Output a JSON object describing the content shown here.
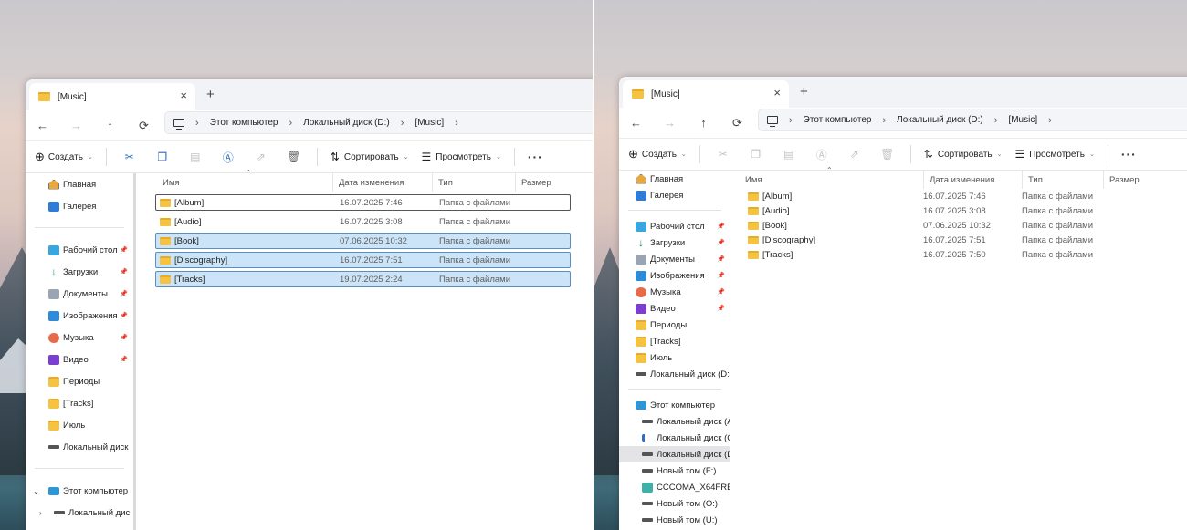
{
  "colors": {
    "folder": "#f5c342",
    "selection": "#cce4f7",
    "selection_border": "#5a8fc4",
    "titlebar": "#f1f3f6"
  },
  "left": {
    "tab": {
      "title": "[Music]",
      "close": "×"
    },
    "new_tab": "+",
    "nav": {
      "back": "←",
      "forward": "→",
      "up": "↑",
      "refresh": "⟳"
    },
    "breadcrumb": [
      "Этот компьютер",
      "Локальный диск (D:)",
      "[Music]"
    ],
    "toolbar": {
      "create": "Создать",
      "sort": "Сортировать",
      "view": "Просмотреть",
      "more": "···"
    },
    "sidebar": [
      {
        "label": "Главная",
        "icon": "home-icon",
        "pin": false
      },
      {
        "label": "Галерея",
        "icon": "gallery-icon",
        "pin": false
      },
      {
        "gap": true
      },
      {
        "label": "Рабочий стол",
        "icon": "desktop-icon",
        "pin": true
      },
      {
        "label": "Загрузки",
        "icon": "download-icon",
        "pin": true
      },
      {
        "label": "Документы",
        "icon": "documents-icon",
        "pin": true
      },
      {
        "label": "Изображения",
        "icon": "images-icon",
        "pin": true
      },
      {
        "label": "Музыка",
        "icon": "music-icon",
        "pin": true
      },
      {
        "label": "Видео",
        "icon": "video-icon",
        "pin": true
      },
      {
        "label": "Периоды",
        "icon": "folder-icon",
        "pin": false
      },
      {
        "label": "[Tracks]",
        "icon": "folder-icon",
        "pin": false
      },
      {
        "label": "Июль",
        "icon": "folder-icon",
        "pin": false
      },
      {
        "label": "Локальный диск",
        "icon": "drive-icon",
        "pin": false
      },
      {
        "gap": true
      },
      {
        "label": "Этот компьютер",
        "icon": "pc-icon",
        "expander": "⌄"
      },
      {
        "label": "Локальный дис",
        "icon": "drive-icon",
        "expander": "›",
        "indent": true
      }
    ],
    "columns": [
      "Имя",
      "Дата изменения",
      "Тип",
      "Размер"
    ],
    "rows": [
      {
        "name": "[Album]",
        "date": "16.07.2025 7:46",
        "type": "Папка с файлами",
        "state": "focused"
      },
      {
        "name": "[Audio]",
        "date": "16.07.2025 3:08",
        "type": "Папка с файлами",
        "state": ""
      },
      {
        "name": "[Book]",
        "date": "07.06.2025 10:32",
        "type": "Папка с файлами",
        "state": "selected"
      },
      {
        "name": "[Discography]",
        "date": "16.07.2025 7:51",
        "type": "Папка с файлами",
        "state": "selected"
      },
      {
        "name": "[Tracks]",
        "date": "19.07.2025 2:24",
        "type": "Папка с файлами",
        "state": "selected"
      }
    ]
  },
  "right": {
    "tab": {
      "title": "[Music]",
      "close": "×"
    },
    "new_tab": "+",
    "nav": {
      "back": "←",
      "forward": "→",
      "up": "↑",
      "refresh": "⟳"
    },
    "breadcrumb": [
      "Этот компьютер",
      "Локальный диск (D:)",
      "[Music]"
    ],
    "toolbar": {
      "create": "Создать",
      "sort": "Сортировать",
      "view": "Просмотреть",
      "more": "···"
    },
    "sidebar": [
      {
        "label": "Главная",
        "icon": "home-icon",
        "pin": false
      },
      {
        "label": "Галерея",
        "icon": "gallery-icon",
        "pin": false
      },
      {
        "gap": true
      },
      {
        "label": "Рабочий стол",
        "icon": "desktop-icon",
        "pin": true
      },
      {
        "label": "Загрузки",
        "icon": "download-icon",
        "pin": true
      },
      {
        "label": "Документы",
        "icon": "documents-icon",
        "pin": true
      },
      {
        "label": "Изображения",
        "icon": "images-icon",
        "pin": true
      },
      {
        "label": "Музыка",
        "icon": "music-icon",
        "pin": true
      },
      {
        "label": "Видео",
        "icon": "video-icon",
        "pin": true
      },
      {
        "label": "Периоды",
        "icon": "folder-icon",
        "pin": false
      },
      {
        "label": "[Tracks]",
        "icon": "folder-icon",
        "pin": false
      },
      {
        "label": "Июль",
        "icon": "folder-icon",
        "pin": false
      },
      {
        "label": "Локальный диск (D:)",
        "icon": "drive-icon",
        "pin": false
      },
      {
        "gap": true
      },
      {
        "label": "Этот компьютер",
        "icon": "pc-icon"
      },
      {
        "label": "Локальный диск (A:",
        "icon": "drive-icon",
        "indent": true
      },
      {
        "label": "Локальный диск (C:",
        "icon": "drive-c-icon",
        "indent": true
      },
      {
        "label": "Локальный диск (D:",
        "icon": "drive-icon",
        "indent": true,
        "selected": true
      },
      {
        "label": "Новый том (F:)",
        "icon": "drive-icon",
        "indent": true
      },
      {
        "label": "CCCOMA_X64FRE_R",
        "icon": "cd-icon",
        "indent": true
      },
      {
        "label": "Новый том (O:)",
        "icon": "drive-icon",
        "indent": true
      },
      {
        "label": "Новый том (U:)",
        "icon": "drive-icon",
        "indent": true
      }
    ],
    "columns": [
      "Имя",
      "Дата изменения",
      "Тип",
      "Размер"
    ],
    "rows": [
      {
        "name": "[Album]",
        "date": "16.07.2025 7:46",
        "type": "Папка с файлами",
        "state": ""
      },
      {
        "name": "[Audio]",
        "date": "16.07.2025 3:08",
        "type": "Папка с файлами",
        "state": ""
      },
      {
        "name": "[Book]",
        "date": "07.06.2025 10:32",
        "type": "Папка с файлами",
        "state": ""
      },
      {
        "name": "[Discography]",
        "date": "16.07.2025 7:51",
        "type": "Папка с файлами",
        "state": ""
      },
      {
        "name": "[Tracks]",
        "date": "16.07.2025 7:50",
        "type": "Папка с файлами",
        "state": ""
      }
    ]
  }
}
